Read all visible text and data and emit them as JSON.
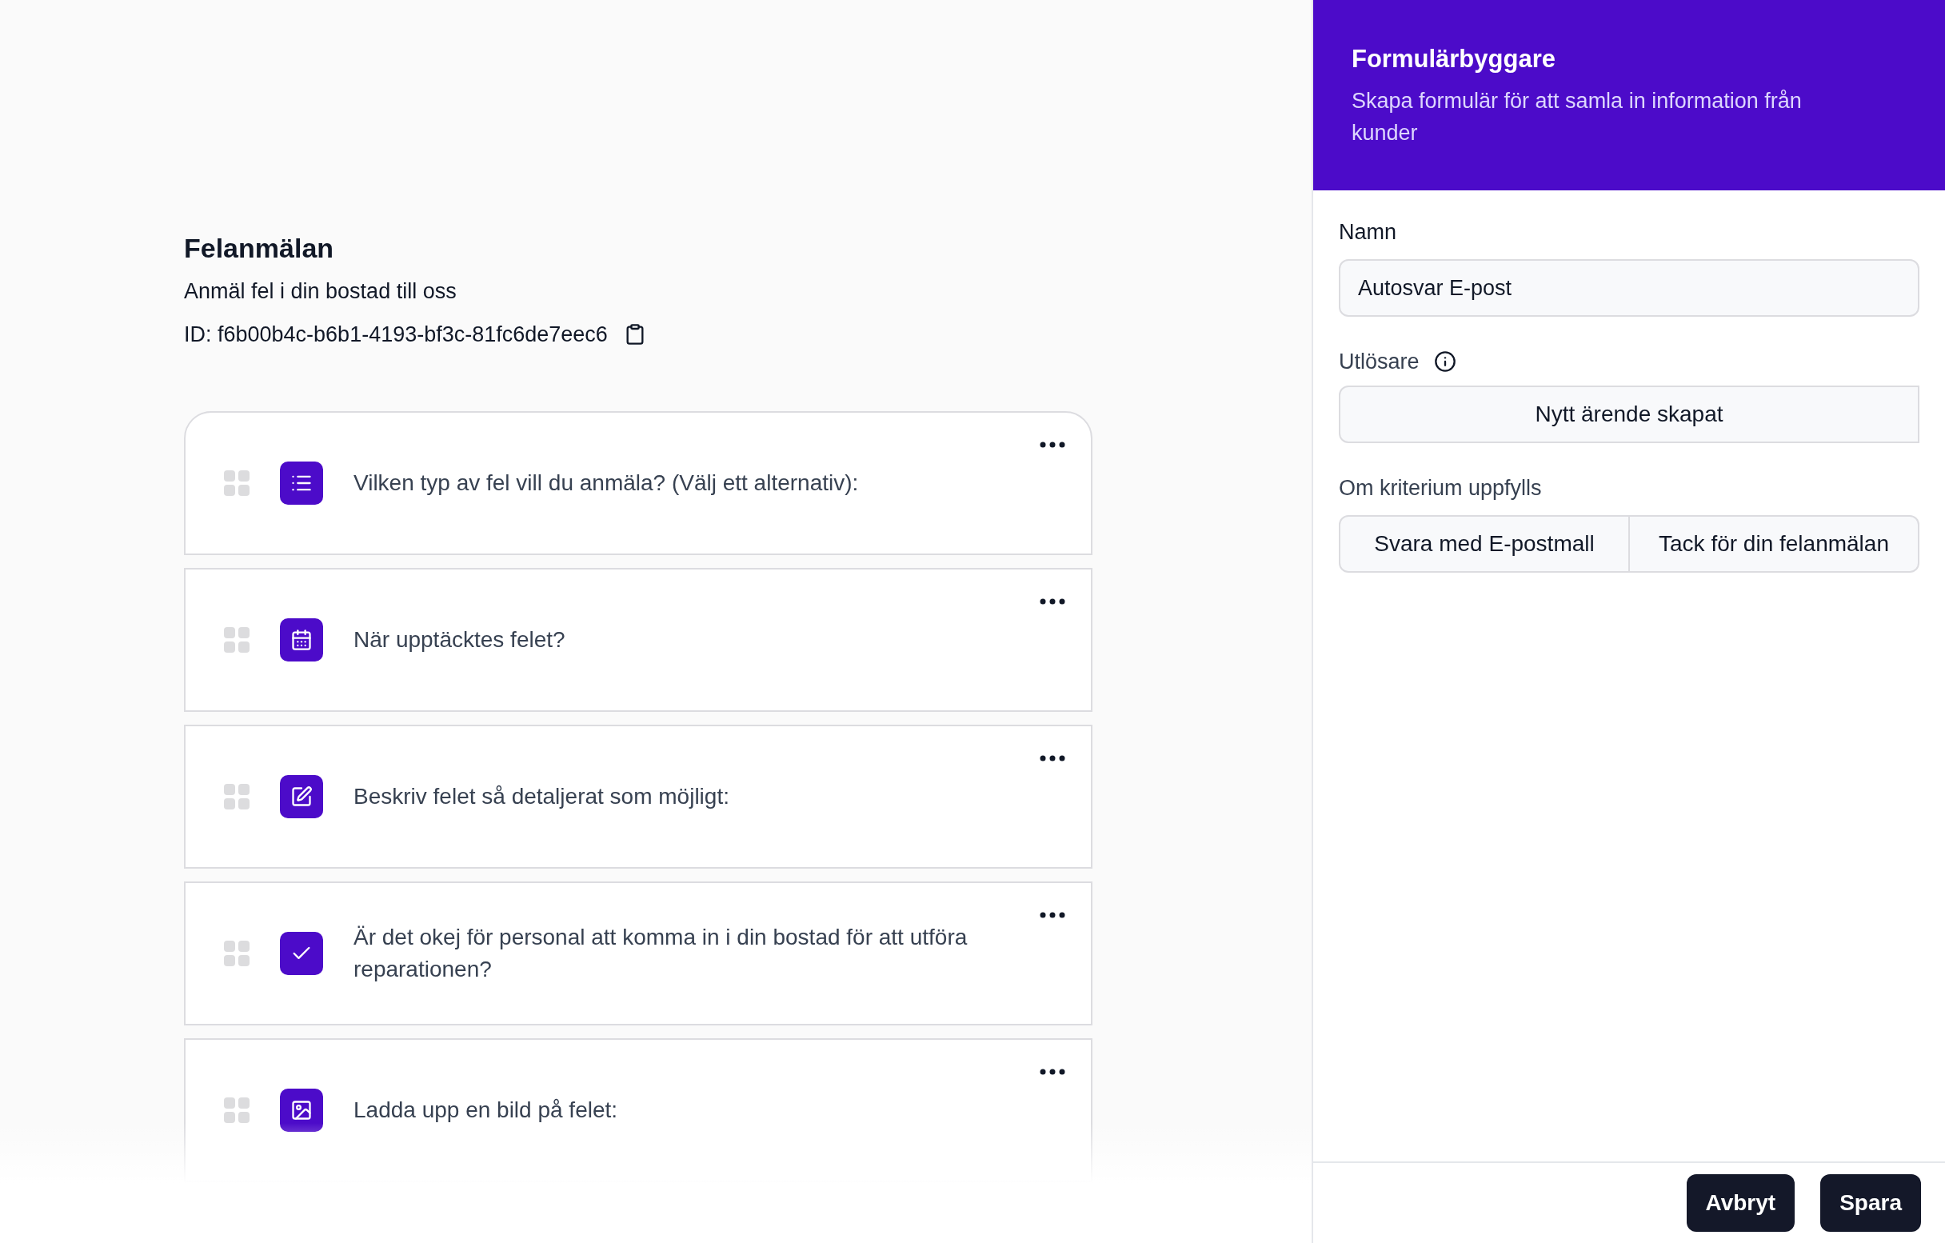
{
  "form": {
    "title": "Felanmälan",
    "description": "Anmäl fel i din bostad till oss",
    "id": "ID: f6b00b4c-b6b1-4193-bf3c-81fc6de7eec6"
  },
  "questions": [
    {
      "kind": "list",
      "text": "Vilken typ av fel vill du anmäla? (Välj ett alternativ):"
    },
    {
      "kind": "date",
      "text": "När upptäcktes felet?"
    },
    {
      "kind": "text",
      "text": "Beskriv felet så detaljerat som möjligt:"
    },
    {
      "kind": "checkbox",
      "text": "Är det okej för personal att komma in i din bostad för att utföra reparationen?"
    },
    {
      "kind": "image",
      "text": "Ladda upp en bild på felet:"
    }
  ],
  "panel": {
    "title": "Formulärbyggare",
    "subtitle": "Skapa formulär för att samla in information från kunder",
    "name_label": "Namn",
    "name_value": "Autosvar E-post",
    "trigger_label": "Utlösare",
    "trigger_value": "Nytt ärende skapat",
    "criteria_label": "Om kriterium uppfylls",
    "criteria_action": "Svara med E-postmall",
    "criteria_template": "Tack för din felanmälan",
    "buttons": [
      "Avbryt",
      "Spara"
    ]
  }
}
